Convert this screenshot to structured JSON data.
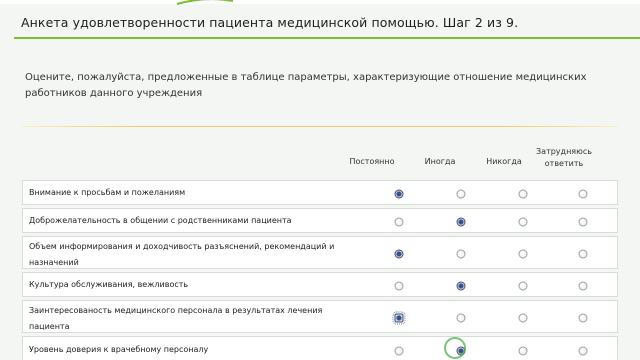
{
  "survey": {
    "title": "Анкета удовлетворенности пациента медицинской помощью. Шаг 2 из 9.",
    "description": "Оцените, пожалуйста, предложенные в таблице параметры, характеризующие отношение медицинских работников данного учреждения"
  },
  "columns": [
    {
      "label": "Постоянно"
    },
    {
      "label": "Иногда"
    },
    {
      "label": "Никогда"
    },
    {
      "label": "Затрудняюсь ответить"
    }
  ],
  "rows": [
    {
      "label": "Внимание к просьбам и пожеланиям",
      "selected": "Постоянно"
    },
    {
      "label": "Доброжелательность в общении с родственниками пациента",
      "selected": "Иногда"
    },
    {
      "label": "Объем информирования и доходчивость разъяснений, рекомендаций и назначений",
      "selected": "Постоянно"
    },
    {
      "label": "Культура обслуживания, вежливость",
      "selected": "Иногда"
    },
    {
      "label": "Заинтересованость медицинского персонала в результатах лечения пациента",
      "selected": "Постоянно"
    },
    {
      "label": "Уровень доверия к врачебному персоналу",
      "selected": "Иногда"
    }
  ],
  "colors": {
    "accent_rule": "#7cbe30",
    "section_rule": "#e8cc6a",
    "selected_radio": "#3b4d86",
    "cursor_highlight": "#4cae4c"
  }
}
